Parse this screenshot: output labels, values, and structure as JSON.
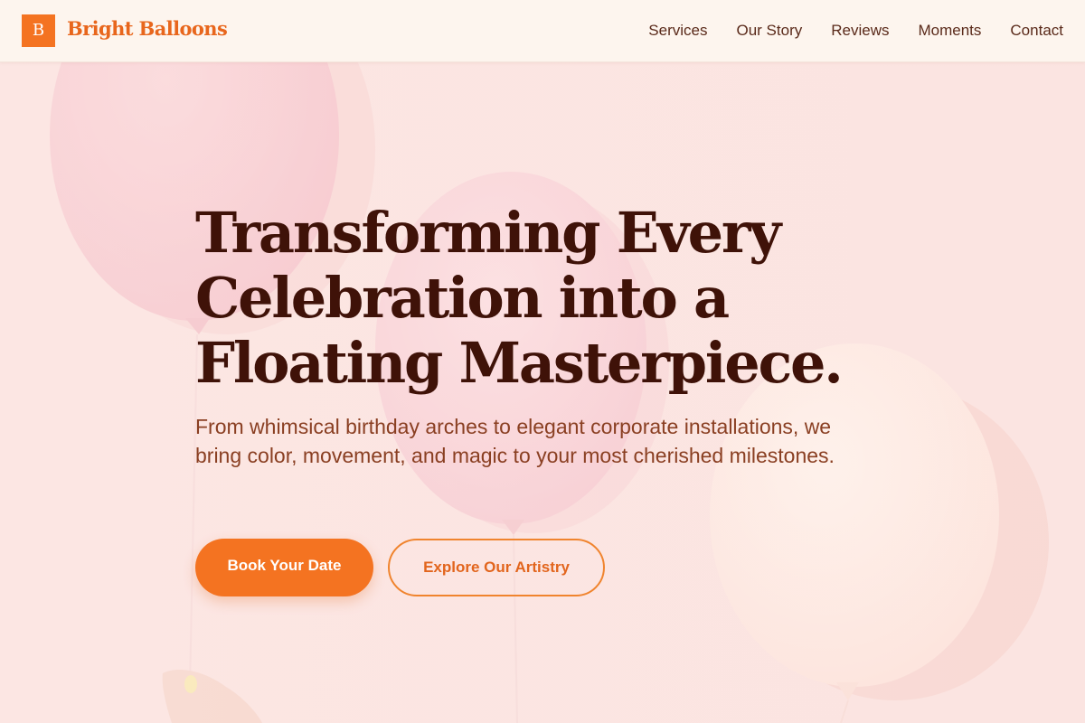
{
  "brand": {
    "logo_letter": "B",
    "name": "Bright Balloons"
  },
  "nav": {
    "items": [
      {
        "label": "Services"
      },
      {
        "label": "Our Story"
      },
      {
        "label": "Reviews"
      },
      {
        "label": "Moments"
      },
      {
        "label": "Contact"
      }
    ]
  },
  "hero": {
    "title_lines": [
      "Transforming Every",
      "Celebration into a",
      "Floating Masterpiece."
    ],
    "subtitle": "From whimsical birthday arches to elegant corporate installations, we bring color, movement, and magic to your most cherished milestones.",
    "primary_cta": "Book Your Date",
    "secondary_cta": "Explore Our Artistry"
  },
  "colors": {
    "accent": "#f47321",
    "heading": "#3f1208",
    "body_text": "#8a3f22",
    "nav_text": "#5a2a1a",
    "background": "#fbe4e1",
    "header_bg": "#fdf5ee"
  }
}
